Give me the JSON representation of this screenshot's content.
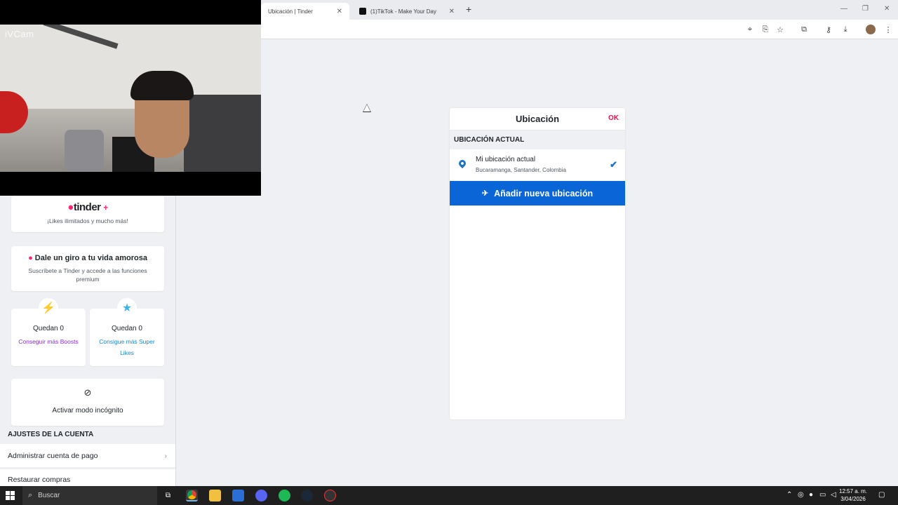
{
  "browser": {
    "tabs": [
      {
        "title": "Ubicación | Tinder",
        "active": true
      },
      {
        "title": "(1)TikTok - Make Your Day",
        "active": false
      }
    ],
    "toolbar_icons": [
      "location-icon",
      "install-icon",
      "star-icon",
      "extensions-icon",
      "key-icon",
      "download-icon",
      "profile-avatar",
      "menu-icon"
    ]
  },
  "webcam": {
    "label": "iVCam"
  },
  "sidebar": {
    "tinder_plus": {
      "logo": "tinder",
      "plus": "+",
      "tagline": "¡Likes ilimitados y mucho más!"
    },
    "promo": {
      "title": "Dale un giro a tu vida amorosa",
      "subtitle": "Suscríbete a Tinder y accede a las funciones premium"
    },
    "boosts": {
      "count_label": "Quedan 0",
      "link": "Conseguir más Boosts"
    },
    "superlikes": {
      "count_label": "Quedan 0",
      "link": "Consigue más Super Likes"
    },
    "incognito": {
      "label": "Activar modo incógnito"
    },
    "account_section": "AJUSTES DE LA CUENTA",
    "rows": [
      {
        "label": "Administrar cuenta de pago"
      },
      {
        "label": "Restaurar compras"
      }
    ]
  },
  "location_panel": {
    "title": "Ubicación",
    "ok": "OK",
    "section": "UBICACIÓN ACTUAL",
    "current": {
      "name": "Mi ubicación actual",
      "detail": "Bucaramanga, Santander, Colombia"
    },
    "add_button": "Añadir nueva ubicación"
  },
  "taskbar": {
    "search_placeholder": "Buscar",
    "time": "12:57 a. m.",
    "date": "3/04/2026"
  },
  "colors": {
    "accent_blue": "#0a66d6",
    "tinder_pink": "#fd267d",
    "ok_red": "#e8174f"
  }
}
